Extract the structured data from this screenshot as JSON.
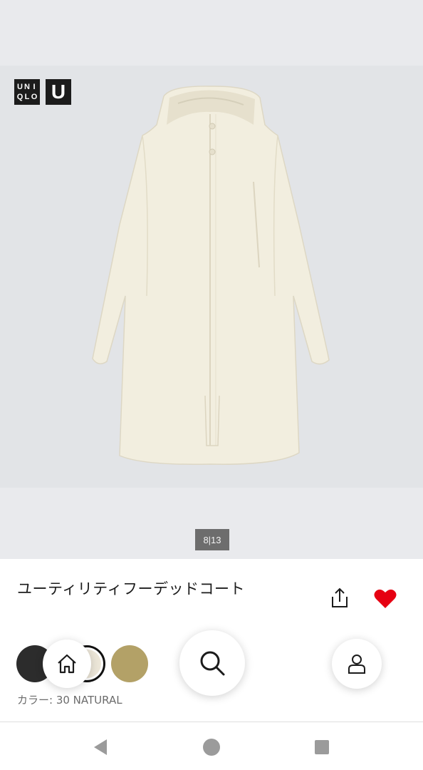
{
  "brand": {
    "logo_letters": [
      "U",
      "N",
      "I",
      "Q",
      "L",
      "O"
    ],
    "logo_u": "U"
  },
  "gallery": {
    "counter": "8|13"
  },
  "product": {
    "title": "ユーティリティフーデッドコート",
    "favorited": true,
    "color_label": "カラー: 30 NATURAL",
    "swatches": [
      {
        "name": "black",
        "color": "#2c2c2c",
        "selected": false
      },
      {
        "name": "natural",
        "color": "#ece6d8",
        "selected": true
      },
      {
        "name": "olive",
        "color": "#b3a167",
        "selected": false
      }
    ]
  },
  "icons": {
    "share": "share-icon",
    "favorite": "heart-icon",
    "home": "home-icon",
    "search": "search-icon",
    "account": "account-icon",
    "system_back": "back-triangle-icon",
    "system_home": "home-circle-icon",
    "system_recent": "recent-square-icon"
  },
  "colors": {
    "favorite": "#e60012",
    "image_bg": "#e2e4e7"
  }
}
